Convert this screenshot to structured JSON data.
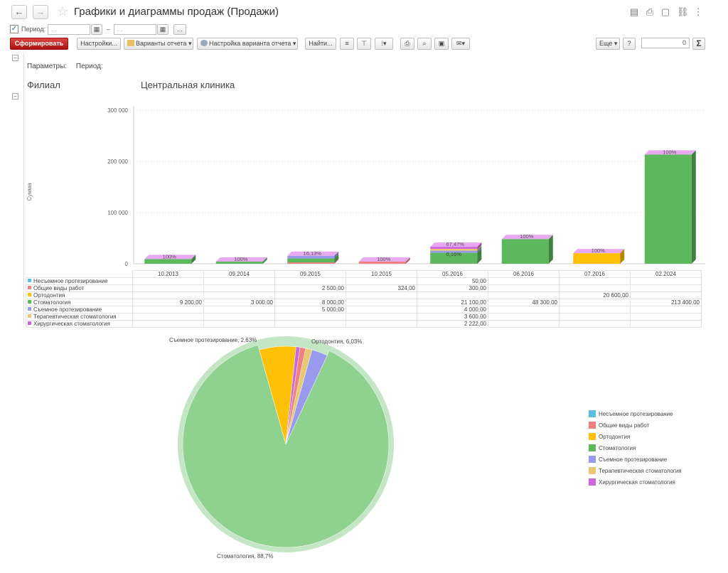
{
  "window": {
    "title": "Графики и диаграммы продаж (Продажи)"
  },
  "period": {
    "label": "Период:",
    "from_placeholder": " . .",
    "to_placeholder": " . .",
    "dash": "–",
    "more_btn": "..."
  },
  "toolbar": {
    "generate": "Сформировать",
    "settings": "Настройки...",
    "variants": "Варианты отчета",
    "variant_settings": "Настройка варианта отчета",
    "find": "Найти...",
    "more": "Еще",
    "help": "?",
    "sum_value": "0",
    "sum_icon": "Σ"
  },
  "report": {
    "params_label": "Параметры:",
    "params_period": "Период:",
    "branch_label": "Филиал",
    "branch_value": "Центральная клиника"
  },
  "colors": {
    "Несъемное протезирование": "#5bc0de",
    "Общие виды работ": "#f08080",
    "Ортодонтия": "#ffc107",
    "Стоматология": "#5cb85c",
    "Съемное протезирование": "#9999ee",
    "Терапевтическая стоматология": "#e8c870",
    "Хирургическая стоматология": "#cc66dd"
  },
  "chart_data": [
    {
      "type": "bar",
      "stacked": true,
      "ylabel": "Сумма",
      "ylim": [
        0,
        300000
      ],
      "yticks": [
        "300 000",
        "200 000",
        "100 000",
        "0"
      ],
      "ytick_values": [
        300000,
        200000,
        100000,
        0
      ],
      "categories": [
        "10.2013",
        "09.2014",
        "09.2015",
        "10.2015",
        "05.2016",
        "06.2016",
        "07.2016",
        "02.2024"
      ],
      "series": [
        {
          "name": "Несъемное протезирование",
          "values": [
            0,
            0,
            0,
            0,
            50,
            0,
            0,
            0
          ],
          "labels": [
            "",
            "",
            "",
            "",
            "50,00",
            "",
            "",
            ""
          ]
        },
        {
          "name": "Общие виды работ",
          "values": [
            0,
            0,
            2500,
            324,
            300,
            0,
            0,
            0
          ],
          "labels": [
            "",
            "",
            "2 500,00",
            "324,00",
            "300,00",
            "",
            "",
            ""
          ]
        },
        {
          "name": "Ортодонтия",
          "values": [
            0,
            0,
            0,
            0,
            0,
            0,
            20600,
            0
          ],
          "labels": [
            "",
            "",
            "",
            "",
            "",
            "",
            "20 600,00",
            ""
          ]
        },
        {
          "name": "Стоматология",
          "values": [
            9200,
            3000,
            8000,
            0,
            21100,
            48300,
            0,
            213400
          ],
          "labels": [
            "9 200,00",
            "3 000,00",
            "8 000,00",
            "",
            "21 100,00",
            "48 300,00",
            "",
            "213 400,00"
          ]
        },
        {
          "name": "Съемное протезирование",
          "values": [
            0,
            0,
            5000,
            0,
            4000,
            0,
            0,
            0
          ],
          "labels": [
            "",
            "",
            "5 000,00",
            "",
            "4 000,00",
            "",
            "",
            ""
          ]
        },
        {
          "name": "Терапевтическая стоматология",
          "values": [
            0,
            0,
            0,
            0,
            3600,
            0,
            0,
            0
          ],
          "labels": [
            "",
            "",
            "",
            "",
            "3 600,00",
            "",
            "",
            ""
          ]
        },
        {
          "name": "Хирургическая стоматология",
          "values": [
            0,
            0,
            0,
            0,
            2222,
            0,
            0,
            0
          ],
          "labels": [
            "",
            "",
            "",
            "",
            "2 222,00",
            "",
            "",
            ""
          ]
        }
      ],
      "top_labels": [
        "100%",
        "100%",
        "16,13%",
        "100%",
        "67,47%",
        "100%",
        "100%",
        "100%"
      ],
      "inner_labels": [
        "",
        "",
        "",
        "",
        "0,16%",
        "",
        "",
        ""
      ]
    },
    {
      "type": "pie",
      "slices": [
        {
          "name": "Стоматология",
          "value": 88.7,
          "label": "Стоматология, 88,7%"
        },
        {
          "name": "Ортодонтия",
          "value": 6.03,
          "label": "Ортодонтия, 6,03%"
        },
        {
          "name": "Хирургическая стоматология",
          "value": 0.65,
          "label": ""
        },
        {
          "name": "Общие виды работ",
          "value": 0.92,
          "label": ""
        },
        {
          "name": "Терапевтическая стоматология",
          "value": 1.07,
          "label": ""
        },
        {
          "name": "Съемное протезирование",
          "value": 2.63,
          "label": "Съемное протезирование, 2,63%"
        }
      ],
      "legend": [
        "Несъемное протезирование",
        "Общие виды работ",
        "Ортодонтия",
        "Стоматология",
        "Съемное протезирование",
        "Терапевтическая стоматология",
        "Хирургическая стоматология"
      ],
      "legend_position": "right"
    }
  ]
}
